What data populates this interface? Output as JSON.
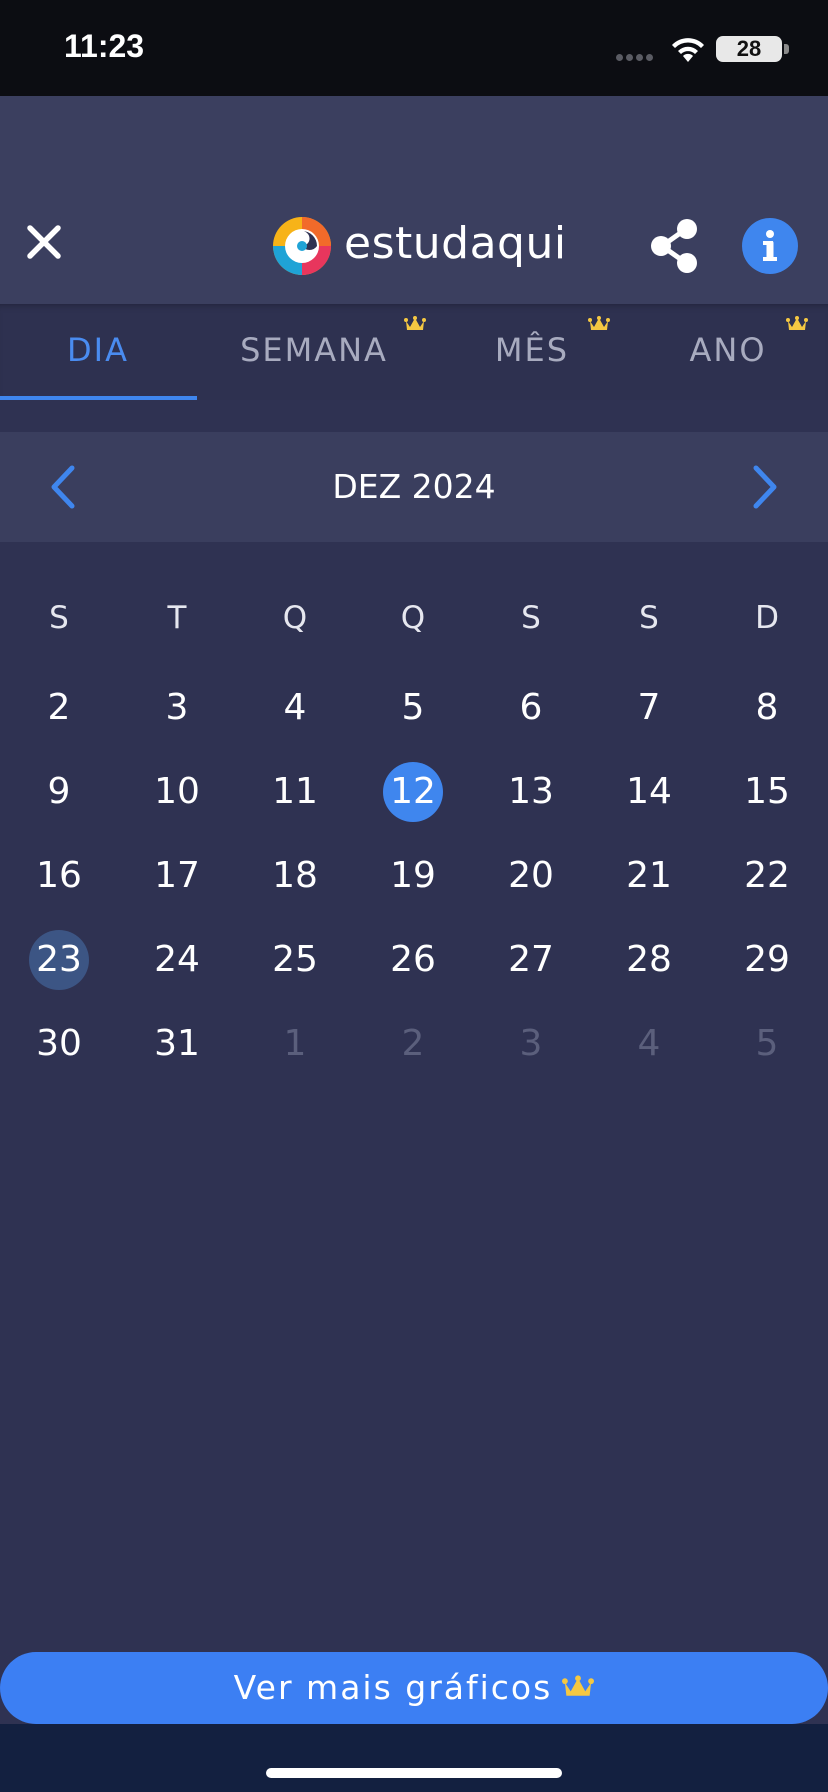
{
  "status_bar": {
    "time": "11:23",
    "battery": "28"
  },
  "header": {
    "logo_text": "estudaqui",
    "icons": [
      "close-icon",
      "logo-icon",
      "share-icon",
      "info-icon"
    ],
    "info_glyph": "i"
  },
  "tabs": [
    {
      "label": "DIA",
      "active": true,
      "premium": false
    },
    {
      "label": "SEMANA",
      "active": false,
      "premium": true
    },
    {
      "label": "MÊS",
      "active": false,
      "premium": true
    },
    {
      "label": "ANO",
      "active": false,
      "premium": true
    }
  ],
  "month_nav": {
    "title": "DEZ 2024",
    "prev_icon": "chevron-left-icon",
    "next_icon": "chevron-right-icon"
  },
  "calendar": {
    "weekdays": [
      "S",
      "T",
      "Q",
      "Q",
      "S",
      "S",
      "D"
    ],
    "weeks": [
      [
        "2",
        "3",
        "4",
        "5",
        "6",
        "7",
        "8"
      ],
      [
        "9",
        "10",
        "11",
        "12",
        "13",
        "14",
        "15"
      ],
      [
        "16",
        "17",
        "18",
        "19",
        "20",
        "21",
        "22"
      ],
      [
        "23",
        "24",
        "25",
        "26",
        "27",
        "28",
        "29"
      ],
      [
        "30",
        "31",
        "1",
        "2",
        "3",
        "4",
        "5"
      ]
    ],
    "selected_day": "12",
    "today": "23",
    "muted_last_week_from_index": 2
  },
  "cta": {
    "label": "Ver mais gráficos"
  },
  "colors": {
    "accent": "#3f86ee",
    "background": "#2f3252",
    "header": "#3b3f5f",
    "crown": "#f5c842",
    "today_circle": "#3c5584"
  }
}
